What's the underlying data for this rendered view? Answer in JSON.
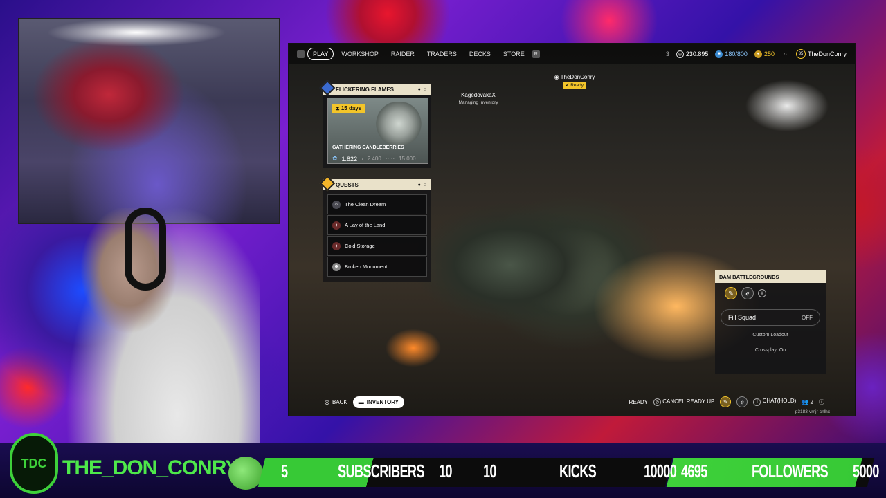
{
  "topbar": {
    "nav": [
      "PLAY",
      "WORKSHOP",
      "RAIDER",
      "TRADERS",
      "DECKS",
      "STORE"
    ],
    "stats": {
      "level_small": "3",
      "coins": "230.895",
      "stash": "180/800",
      "tokens": "250",
      "player_level": "35",
      "username": "TheDonConry"
    }
  },
  "event": {
    "header": "FLICKERING FLAMES",
    "days": "15 days",
    "title": "GATHERING CANDLEBERRIES",
    "progress": "1.822",
    "next": "2.400",
    "goal": "15.000"
  },
  "quests": {
    "header": "QUESTS",
    "items": [
      "The Clean Dream",
      "A Lay of the Land",
      "Cold Storage",
      "Broken Monument"
    ]
  },
  "players": {
    "teammate_name": "KagedovakaX",
    "teammate_status": "Managing Inventory",
    "self_name": "TheDonConry",
    "self_status": "Ready"
  },
  "squad": {
    "map": "DAM BATTLEGROUNDS",
    "fill_label": "Fill Squad",
    "fill_value": "OFF",
    "loadout": "Custom Loadout",
    "crossplay": "Crossplay: On"
  },
  "bottom": {
    "back": "BACK",
    "inventory": "INVENTORY",
    "ready": "READY",
    "cancel_ready": "CANCEL READY UP",
    "chat": "CHAT(HOLD)",
    "party_count": "2",
    "code": "p3183-vrnjr-cnlhx"
  },
  "overlay": {
    "channel": "THE_DON_CONRY",
    "logo": "TDC",
    "sub_current": "5",
    "sub_label": "SUBSCRIBERS",
    "sub_goal": "10",
    "kick_current": "10",
    "kick_label": "KICKS",
    "kick_goal": "10000",
    "fol_current": "4695",
    "fol_label": "FOLLOWERS",
    "fol_goal": "5000"
  },
  "colors": {
    "accent": "#f3c52a",
    "overlay_green": "#3ed13a",
    "panel_header": "#e9e1c9"
  }
}
